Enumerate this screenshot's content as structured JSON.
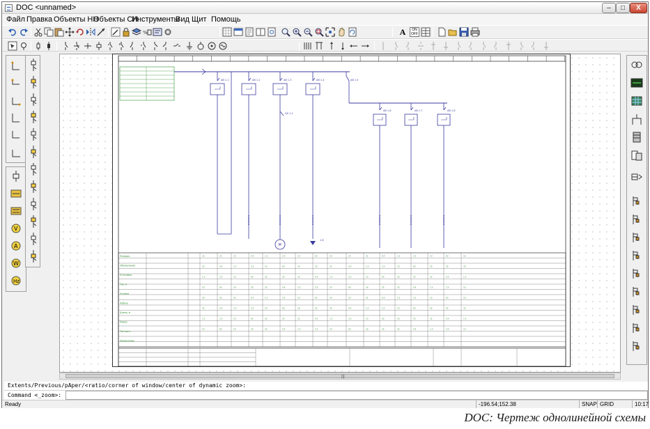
{
  "window": {
    "title": "DOC <unnamed>",
    "minimize_label": "–",
    "maximize_label": "□",
    "close_label": "X"
  },
  "menu": [
    "Файл",
    "Правка",
    "Объекты НН",
    "Объекты СН",
    "Инструменты",
    "Вид",
    "Щит",
    "Помощь"
  ],
  "toolbar": {
    "text_tool_label": "A",
    "on_off_label": "ON OFF"
  },
  "diagram": {
    "breakers": [
      "АВ 1.1",
      "АВ 1.2",
      "АВ 1.3",
      "АВ 1.4",
      "АВ 1.5",
      "АВ 1.6",
      "АВ 1.7",
      "АВ 1.8"
    ],
    "switch_label": "QS 1.1",
    "motor_label": "M",
    "ground_label": "1.6",
    "table_rows": [
      "Позиция",
      "Обозначение",
      "Установка",
      "Ток, А",
      "Уставка",
      "Кабель",
      "Длина, м",
      "Марка",
      "Ток расч.",
      "Примечание"
    ]
  },
  "command": {
    "history": "Extents/Previous/pAper/<ratio/corner of window/center of dynamic zoom>:",
    "prompt": "Command <_zoom>:",
    "input_value": ""
  },
  "status": {
    "left": "Ready",
    "coords": "-196.54;152.38",
    "snap": "SNAP",
    "grid": "GRID",
    "time": "10:17"
  },
  "caption": "DOC: Чертеж однолинейной схемы",
  "colors": {
    "wire": "#3a3aa0",
    "table_text": "#2f8f2f",
    "sheet_border": "#333333"
  }
}
